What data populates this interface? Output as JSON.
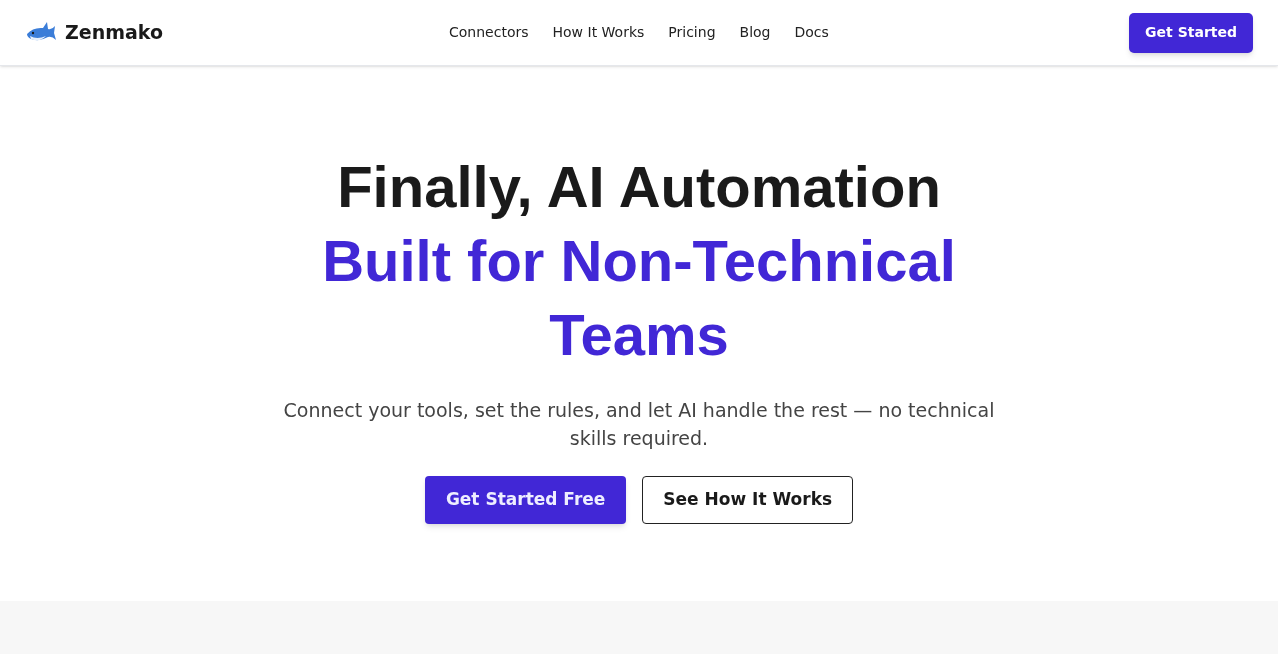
{
  "header": {
    "brand": "Zenmako",
    "nav": [
      "Connectors",
      "How It Works",
      "Pricing",
      "Blog",
      "Docs"
    ],
    "cta": "Get Started"
  },
  "hero": {
    "title": "Finally, AI Automation",
    "title_highlight": "Built for Non-Technical Teams",
    "subtitle": "Connect your tools, set the rules, and let AI handle the rest — no technical skills required.",
    "buttons": [
      {
        "label": "Get Started Free",
        "kind": "primary"
      },
      {
        "label": "See How It Works",
        "kind": "secondary"
      }
    ]
  }
}
